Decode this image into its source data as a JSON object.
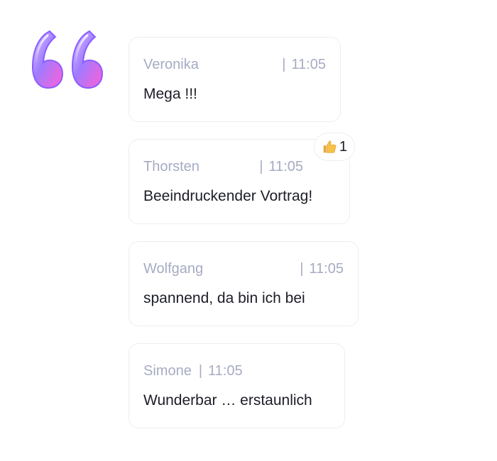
{
  "decoration": {
    "quote_icon": "double-quote-mark-icon",
    "gradient": [
      "#7b5cff",
      "#c78bff",
      "#ff66d9"
    ]
  },
  "messages": [
    {
      "author": "Veronika",
      "time": "11:05",
      "text": "Mega !!!"
    },
    {
      "author": "Thorsten",
      "time": "11:05",
      "text": "Beeindruckender Vortrag!",
      "reaction": {
        "icon": "thumbs-up-icon",
        "count": "1"
      }
    },
    {
      "author": "Wolfgang",
      "time": "11:05",
      "text": "spannend, da bin ich bei"
    },
    {
      "author": "Simone",
      "time": "11:05",
      "text": "Wunderbar … erstaunlich"
    }
  ],
  "colors": {
    "meta_text": "#a7abc3",
    "body_text": "#1c1d27",
    "bubble_border": "#eceef3"
  }
}
